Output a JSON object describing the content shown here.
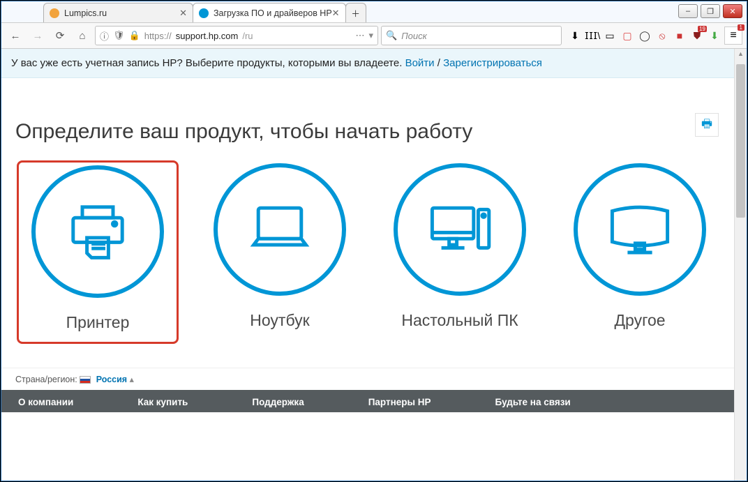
{
  "window": {
    "min": "–",
    "max": "❐",
    "close": "✕"
  },
  "tabs": [
    {
      "title": "Lumpics.ru",
      "favcolor": "#f2a33c",
      "active": false
    },
    {
      "title": "Загрузка ПО и драйверов HP",
      "favcolor": "#0096d6",
      "active": true
    }
  ],
  "newtab_glyph": "＋",
  "nav": {
    "back": "←",
    "fwd": "→",
    "reload": "⟳",
    "home": "⌂"
  },
  "address": {
    "info": "ⓘ",
    "shield": "🛡",
    "lock": "🔒",
    "scheme": "https://",
    "host": "support.hp.com",
    "path": "/ru",
    "dots": "⋯",
    "drop": "▾"
  },
  "search": {
    "icon": "🔍",
    "placeholder": "Поиск"
  },
  "ext": {
    "download": "⬇",
    "library": "𝖨𝖨𝖨\\",
    "reader": "▭",
    "pocket": "▢",
    "opera": "◯",
    "nosign": "⦸",
    "abp": "■",
    "ushield": "⛊",
    "greenarrow": "⬇",
    "menu": "≡"
  },
  "banner": {
    "text": "У вас уже есть учетная запись HP? Выберите продукты, которыми вы владеете. ",
    "login": "Войти",
    "sep": " / ",
    "register": "Зарегистрироваться"
  },
  "heading": "Определите ваш продукт, чтобы начать работу",
  "print_icon": "🖶",
  "products": [
    {
      "label": "Принтер"
    },
    {
      "label": "Ноутбук"
    },
    {
      "label": "Настольный ПК"
    },
    {
      "label": "Другое"
    }
  ],
  "region": {
    "label": "Страна/регион: ",
    "value": "Россия",
    "arrow": "▴"
  },
  "footer": [
    "О компании",
    "Как купить",
    "Поддержка",
    "Партнеры HP",
    "Будьте на связи"
  ]
}
